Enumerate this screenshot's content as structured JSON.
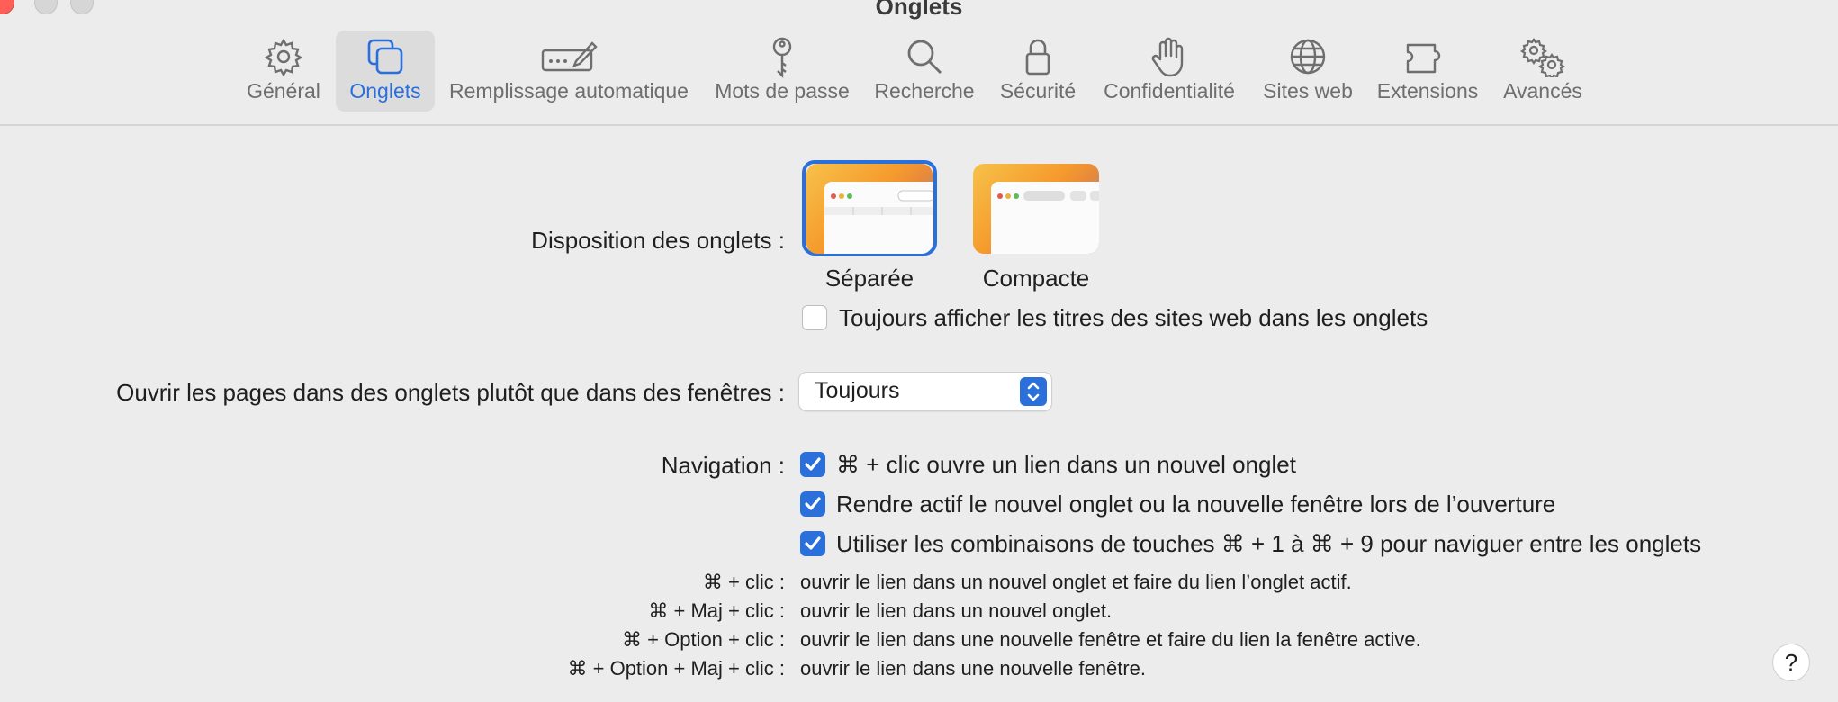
{
  "window": {
    "title": "Onglets"
  },
  "toolbar": {
    "tabs": [
      {
        "label": "Général",
        "icon": "gear-icon"
      },
      {
        "label": "Onglets",
        "icon": "tabs-icon",
        "selected": true
      },
      {
        "label": "Remplissage automatique",
        "icon": "autofill-pen-icon"
      },
      {
        "label": "Mots de passe",
        "icon": "key-icon"
      },
      {
        "label": "Recherche",
        "icon": "magnifier-icon"
      },
      {
        "label": "Sécurité",
        "icon": "lock-icon"
      },
      {
        "label": "Confidentialité",
        "icon": "hand-icon"
      },
      {
        "label": "Sites web",
        "icon": "globe-icon"
      },
      {
        "label": "Extensions",
        "icon": "puzzle-icon"
      },
      {
        "label": "Avancés",
        "icon": "gears-icon"
      }
    ]
  },
  "layout": {
    "label": "Disposition des onglets :",
    "options": [
      {
        "caption": "Séparée",
        "selected": true
      },
      {
        "caption": "Compacte",
        "selected": false
      }
    ],
    "always_show_titles": {
      "label": "Toujours afficher les titres des sites web dans les onglets",
      "checked": false
    }
  },
  "open_pages": {
    "label": "Ouvrir les pages dans des onglets plutôt que dans des fenêtres :",
    "value": "Toujours"
  },
  "navigation": {
    "label": "Navigation :",
    "options": [
      {
        "label": "⌘ + clic ouvre un lien dans un nouvel onglet",
        "checked": true
      },
      {
        "label": "Rendre actif le nouvel onglet ou la nouvelle fenêtre lors de l’ouverture",
        "checked": true
      },
      {
        "label": "Utiliser les combinaisons de touches ⌘ + 1 à ⌘ + 9 pour naviguer entre les onglets",
        "checked": true
      }
    ]
  },
  "hints": [
    {
      "keys": "⌘ + clic :",
      "desc": "ouvrir le lien dans un nouvel onglet et faire du lien l’onglet actif."
    },
    {
      "keys": "⌘ + Maj + clic :",
      "desc": "ouvrir le lien dans un nouvel onglet."
    },
    {
      "keys": "⌘ + Option + clic :",
      "desc": "ouvrir le lien dans une nouvelle fenêtre et faire du lien la fenêtre active."
    },
    {
      "keys": "⌘ + Option + Maj + clic :",
      "desc": "ouvrir le lien dans une nouvelle fenêtre."
    }
  ],
  "help": {
    "label": "?"
  },
  "colors": {
    "accent": "#2b6fdb",
    "background": "#ececec"
  }
}
